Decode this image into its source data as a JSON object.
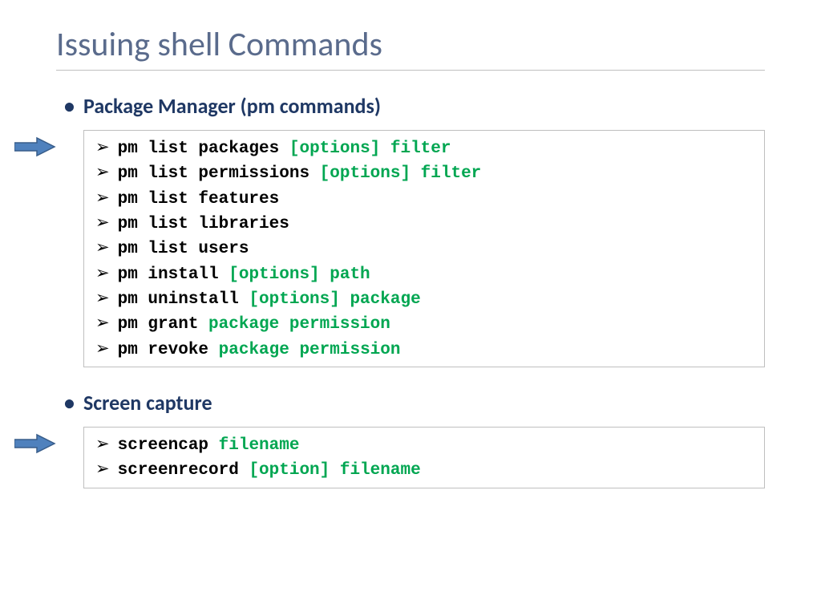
{
  "title": "Issuing shell Commands",
  "sections": [
    {
      "heading": "Package Manager (pm commands)",
      "commands": [
        {
          "cmd": "pm list packages ",
          "args": "[options] filter"
        },
        {
          "cmd": "pm list permissions ",
          "args": "[options] filter"
        },
        {
          "cmd": "pm list features",
          "args": ""
        },
        {
          "cmd": "pm list libraries",
          "args": ""
        },
        {
          "cmd": "pm list users",
          "args": ""
        },
        {
          "cmd": "pm install ",
          "args": "[options] path"
        },
        {
          "cmd": "pm uninstall ",
          "args": "[options] package"
        },
        {
          "cmd": "pm grant ",
          "args": "package permission"
        },
        {
          "cmd": "pm revoke ",
          "args": "package permission"
        }
      ]
    },
    {
      "heading": "Screen capture",
      "commands": [
        {
          "cmd": "screencap ",
          "args": "filename"
        },
        {
          "cmd": "screenrecord ",
          "args": "[option] filename"
        }
      ]
    }
  ],
  "bullet_glyph": "➢"
}
